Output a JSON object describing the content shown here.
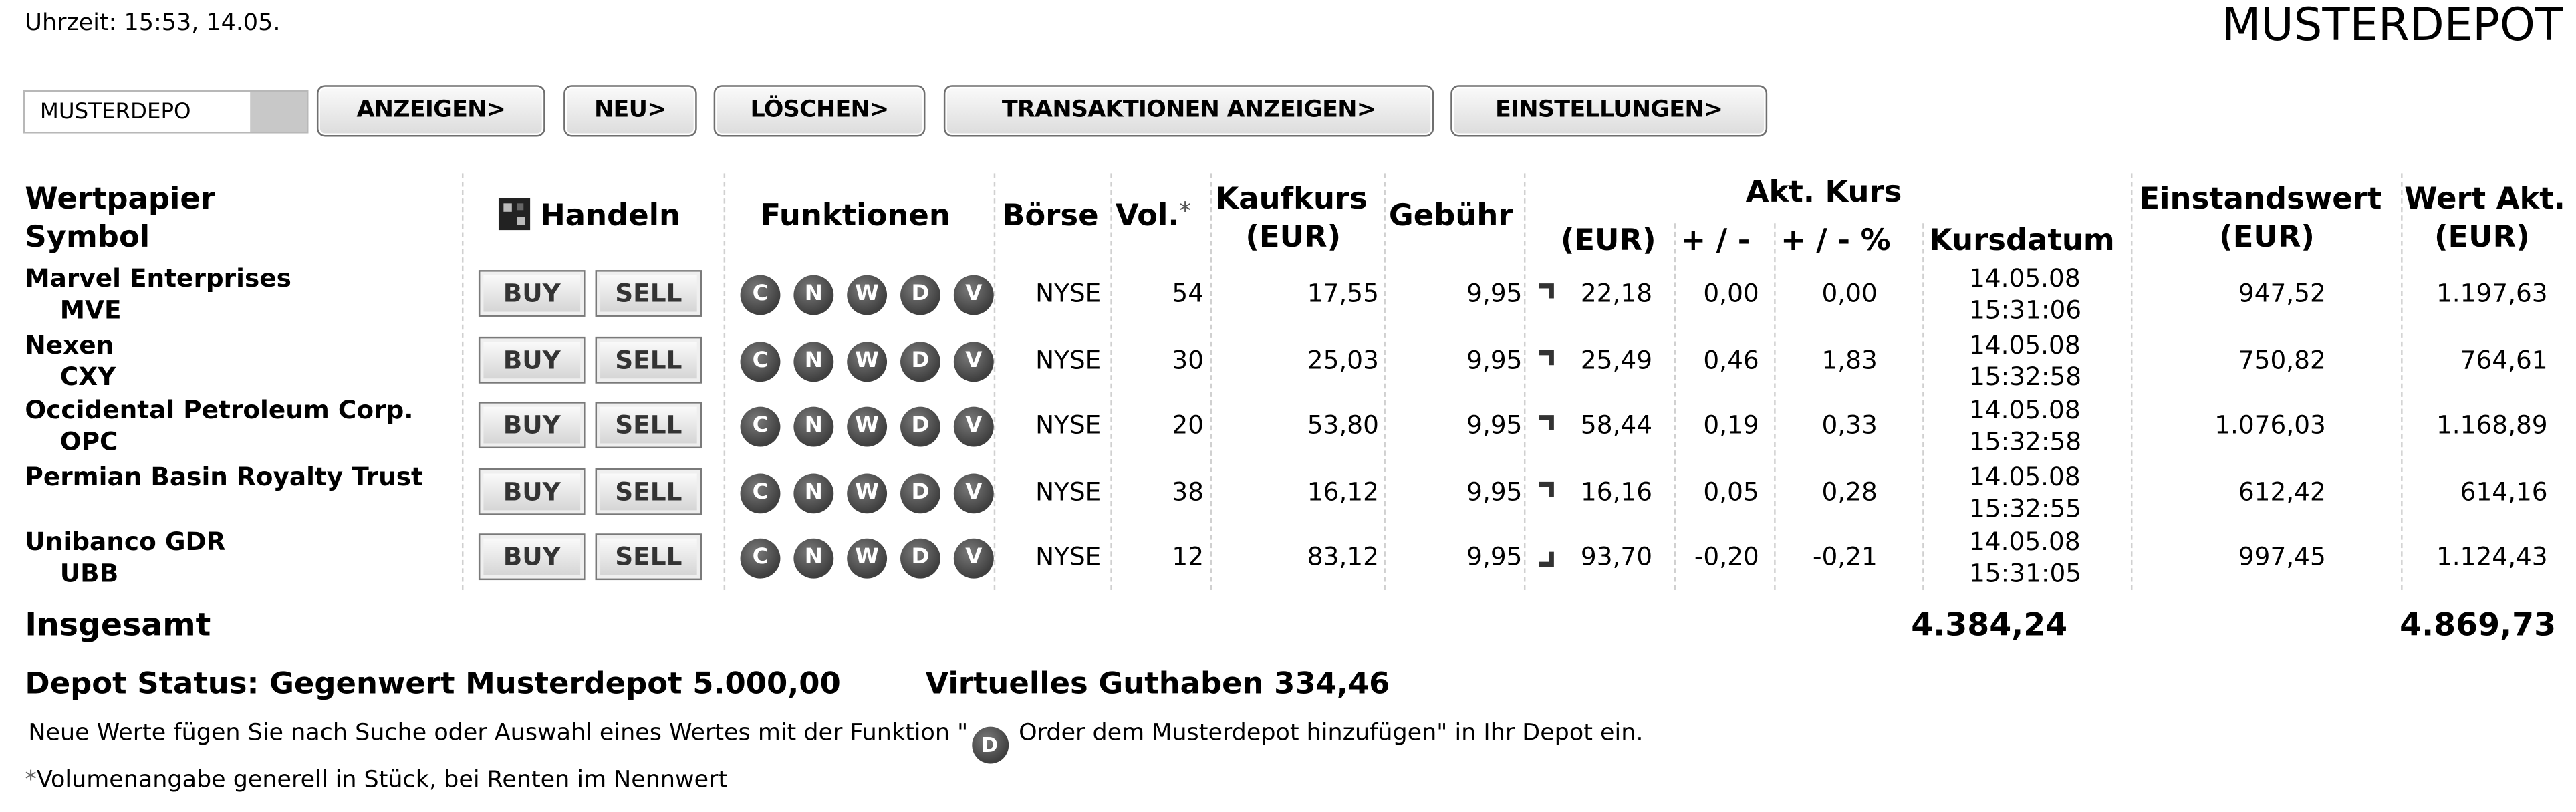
{
  "header": {
    "time_text": "Uhrzeit: 15:53, 14.05.",
    "page_title": "MUSTERDEPOT"
  },
  "toolbar": {
    "depot_value": "MUSTERDEPO",
    "anzeigen": "ANZEIGEN>",
    "neu": "NEU>",
    "loeschen": "LÖSCHEN>",
    "transaktionen": "TRANSAKTIONEN ANZEIGEN>",
    "einstellungen": "EINSTELLUNGEN>"
  },
  "columns": {
    "wertpapier": "Wertpapier",
    "symbol": "Symbol",
    "handeln": "Handeln",
    "funktionen": "Funktionen",
    "boerse": "Börse",
    "vol": "Vol.",
    "vol_star": "*",
    "kaufkurs": "Kaufkurs",
    "kaufkurs_unit": "(EUR)",
    "gebuehr": "Gebühr",
    "akt_kurs": "Akt. Kurs",
    "akt_eur": "(EUR)",
    "plusminus": "+ / -",
    "plusminus_pct": "+ / - %",
    "kursdatum": "Kursdatum",
    "einstandswert": "Einstandswert",
    "einstandswert_unit": "(EUR)",
    "wert_akt": "Wert Akt.",
    "wert_akt_unit": "(EUR)"
  },
  "buttons": {
    "buy": "BUY",
    "sell": "SELL"
  },
  "function_letters": [
    "C",
    "N",
    "W",
    "D",
    "V"
  ],
  "rows": [
    {
      "name": "Marvel Enterprises",
      "symbol": "MVE",
      "exchange": "NYSE",
      "vol": "54",
      "kaufkurs": "17,55",
      "gebuehr": "9,95",
      "trend": "up",
      "akt": "22,18",
      "diff": "0,00",
      "diff_pct": "0,00",
      "date": "14.05.08",
      "time": "15:31:06",
      "einstand": "947,52",
      "wert": "1.197,63"
    },
    {
      "name": "Nexen",
      "symbol": "CXY",
      "exchange": "NYSE",
      "vol": "30",
      "kaufkurs": "25,03",
      "gebuehr": "9,95",
      "trend": "up",
      "akt": "25,49",
      "diff": "0,46",
      "diff_pct": "1,83",
      "date": "14.05.08",
      "time": "15:32:58",
      "einstand": "750,82",
      "wert": "764,61"
    },
    {
      "name": "Occidental Petroleum Corp.",
      "symbol": "OPC",
      "exchange": "NYSE",
      "vol": "20",
      "kaufkurs": "53,80",
      "gebuehr": "9,95",
      "trend": "up",
      "akt": "58,44",
      "diff": "0,19",
      "diff_pct": "0,33",
      "date": "14.05.08",
      "time": "15:32:58",
      "einstand": "1.076,03",
      "wert": "1.168,89"
    },
    {
      "name": "Permian Basin Royalty Trust",
      "symbol": "",
      "exchange": "NYSE",
      "vol": "38",
      "kaufkurs": "16,12",
      "gebuehr": "9,95",
      "trend": "up",
      "akt": "16,16",
      "diff": "0,05",
      "diff_pct": "0,28",
      "date": "14.05.08",
      "time": "15:32:55",
      "einstand": "612,42",
      "wert": "614,16"
    },
    {
      "name": "Unibanco GDR",
      "symbol": "UBB",
      "exchange": "NYSE",
      "vol": "12",
      "kaufkurs": "83,12",
      "gebuehr": "9,95",
      "trend": "down",
      "akt": "93,70",
      "diff": "-0,20",
      "diff_pct": "-0,21",
      "date": "14.05.08",
      "time": "15:31:05",
      "einstand": "997,45",
      "wert": "1.124,43"
    }
  ],
  "totals": {
    "label": "Insgesamt",
    "einstand": "4.384,24",
    "wert": "4.869,73"
  },
  "status": {
    "depot_status": "Depot Status: Gegenwert Musterdepot 5.000,00",
    "guthaben": "Virtuelles Guthaben 334,46"
  },
  "notes": {
    "line1_before": "Neue Werte fügen Sie nach Suche oder Auswahl eines Wertes mit der Funktion \"",
    "line1_icon": "D",
    "line1_after": " Order dem Musterdepot hinzufügen\" in Ihr Depot ein.",
    "line2_star": "*",
    "line2_text": "Volumenangabe generell in Stück, bei Renten im Nennwert"
  }
}
